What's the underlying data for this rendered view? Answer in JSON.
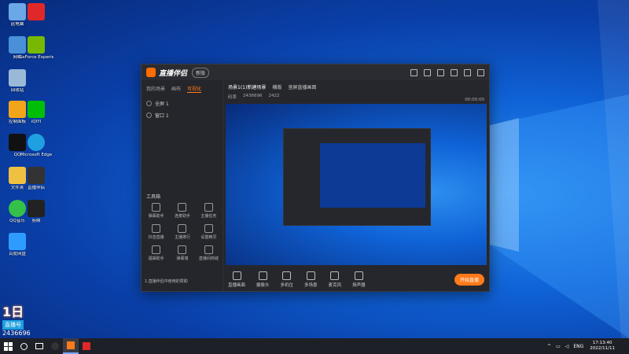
{
  "desktop": {
    "icons": [
      {
        "label": "此电脑",
        "color": "#6aa8e8"
      },
      {
        "label": "网络",
        "color": "#4a90d9"
      },
      {
        "label": "回收站",
        "color": "#9ab8d8"
      },
      {
        "label": "控制面板",
        "color": "#f2a51a"
      },
      {
        "label": "QQ",
        "color": "#111111"
      },
      {
        "label": "文件夹",
        "color": "#f0c040"
      },
      {
        "label": "QQ音乐",
        "color": "#35c04a"
      },
      {
        "label": "百度网盘",
        "color": "#2e9cff"
      },
      {
        "label": "GeForce Experience",
        "color": "#76b900"
      },
      {
        "label": "iQIYI",
        "color": "#00be06"
      },
      {
        "label": "Microsoft Edge",
        "color": "#1fa0e0"
      },
      {
        "label": "直播伴侣",
        "color": "#ffffff"
      },
      {
        "label": "剪映",
        "color": "#222222"
      }
    ]
  },
  "app": {
    "title": "直播伴侣",
    "version": "新版",
    "left_tabs": [
      "我的场景",
      "画布",
      "可视化"
    ],
    "scenes": [
      "全屏 1",
      "窗口 1"
    ],
    "toolbox_title": "工具箱",
    "tools": [
      "弹幕助手",
      "连麦助手",
      "主播任务",
      "抖音直播",
      "主播排行",
      "设置精灵",
      "福袋助手",
      "弹幕墙",
      "直播间商城",
      "音效助手",
      "礼物特效",
      "贴纸"
    ],
    "promo": "1.直播伴侣中使用的赞助",
    "scene_tab": "场景1(1)新建场景",
    "scene_tab2": "横版",
    "scene_tab3": "竖屏直播画面",
    "stats": [
      "码率",
      "2436696",
      "2422"
    ],
    "bottom_tools": [
      "直播画面",
      "摄像头",
      "多机位",
      "多场景",
      "麦克风",
      "扬声器"
    ],
    "live_button": "开始直播",
    "timer": "00:00:00"
  },
  "overlay": {
    "title": "1日",
    "subtitle": "直播号",
    "number": "2436696"
  },
  "taskbar": {
    "time": "17:13:40",
    "date": "2022/11/11",
    "lang": "ENG"
  }
}
